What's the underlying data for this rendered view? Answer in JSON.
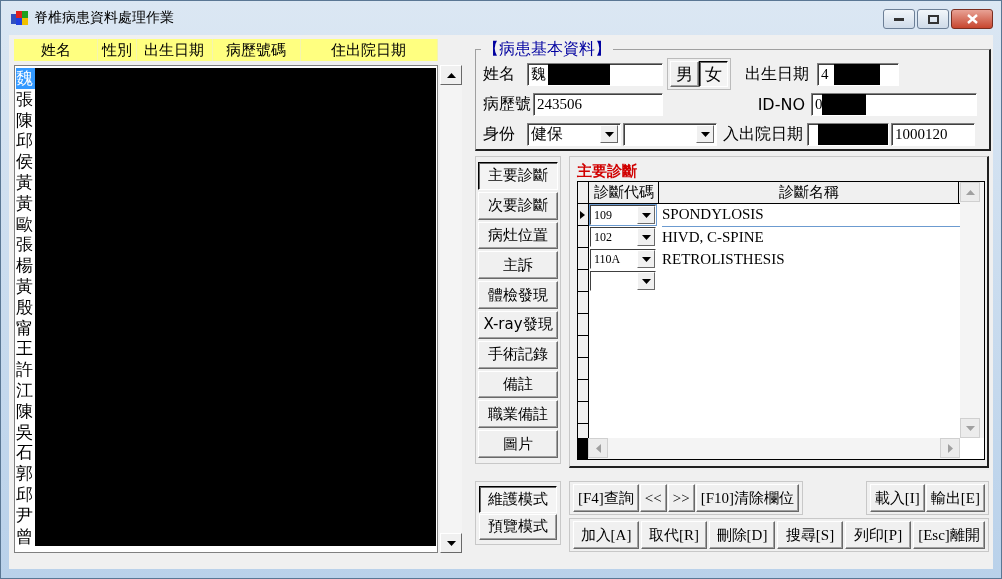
{
  "window": {
    "title": "脊椎病患資料處理作業"
  },
  "patient_list": {
    "columns": [
      "姓名",
      "性別",
      "出生日期",
      "病歷號碼",
      "住出院日期"
    ],
    "rows": [
      {
        "name": "魏",
        "selected": true
      },
      {
        "name": "張",
        "selected": false
      },
      {
        "name": "陳",
        "selected": false
      },
      {
        "name": "邱",
        "selected": false
      },
      {
        "name": "侯",
        "selected": false
      },
      {
        "name": "黃",
        "selected": false
      },
      {
        "name": "黃",
        "selected": false
      },
      {
        "name": "歐",
        "selected": false
      },
      {
        "name": "張",
        "selected": false
      },
      {
        "name": "楊",
        "selected": false
      },
      {
        "name": "黃",
        "selected": false
      },
      {
        "name": "殷",
        "selected": false
      },
      {
        "name": "甯",
        "selected": false
      },
      {
        "name": "王",
        "selected": false
      },
      {
        "name": "許",
        "selected": false
      },
      {
        "name": "江",
        "selected": false
      },
      {
        "name": "陳",
        "selected": false
      },
      {
        "name": "吳",
        "selected": false
      },
      {
        "name": "石",
        "selected": false
      },
      {
        "name": "郭",
        "selected": false
      },
      {
        "name": "邱",
        "selected": false
      },
      {
        "name": "尹",
        "selected": false
      },
      {
        "name": "曾",
        "selected": false
      }
    ]
  },
  "patient_info": {
    "title": "【病患基本資料】",
    "name_label": "姓名",
    "name_value": "魏",
    "sex_buttons": [
      {
        "label": "男",
        "selected": false
      },
      {
        "label": "女",
        "selected": true
      }
    ],
    "birth_label": "出生日期",
    "birth_value": "4",
    "chart_no_label": "病歷號",
    "chart_no_value": "243506",
    "id_label": "ID-NO",
    "id_value": "0",
    "identity_label": "身份",
    "identity_value": "健保",
    "admission_label": "入出院日期",
    "discharge_value": "1000120"
  },
  "section_tabs": [
    {
      "label": "主要診斷",
      "selected": true
    },
    {
      "label": "次要診斷",
      "selected": false
    },
    {
      "label": "病灶位置",
      "selected": false
    },
    {
      "label": "主訴",
      "selected": false
    },
    {
      "label": "體檢發現",
      "selected": false
    },
    {
      "label": "X-ray發現",
      "selected": false
    },
    {
      "label": "手術記錄",
      "selected": false
    },
    {
      "label": "備註",
      "selected": false
    },
    {
      "label": "職業備註",
      "selected": false
    },
    {
      "label": "圖片",
      "selected": false
    }
  ],
  "diagnosis": {
    "title": "主要診斷",
    "columns": [
      "診斷代碼",
      "診斷名稱"
    ],
    "rows": [
      {
        "kind": "entry",
        "code": "109",
        "name": "SPONDYLOSIS",
        "selected": true
      },
      {
        "kind": "entry",
        "code": "102",
        "name": "HIVD, C-SPINE",
        "selected": false
      },
      {
        "kind": "entry",
        "code": "110A",
        "name": "RETROLISTHESIS",
        "selected": false
      },
      {
        "kind": "new"
      }
    ]
  },
  "mode_buttons": [
    {
      "label": "維護模式",
      "selected": true
    },
    {
      "label": "預覽模式",
      "selected": false
    }
  ],
  "toolbar": {
    "query_buttons": [
      "[F4]查詢",
      "<<",
      ">>",
      "[F10]清除欄位"
    ],
    "io_buttons": [
      "載入[I]",
      "輸出[E]"
    ],
    "action_buttons": [
      "加入[A]",
      "取代[R]",
      "刪除[D]",
      "搜尋[S]",
      "列印[P]",
      "[Esc]離開"
    ]
  }
}
